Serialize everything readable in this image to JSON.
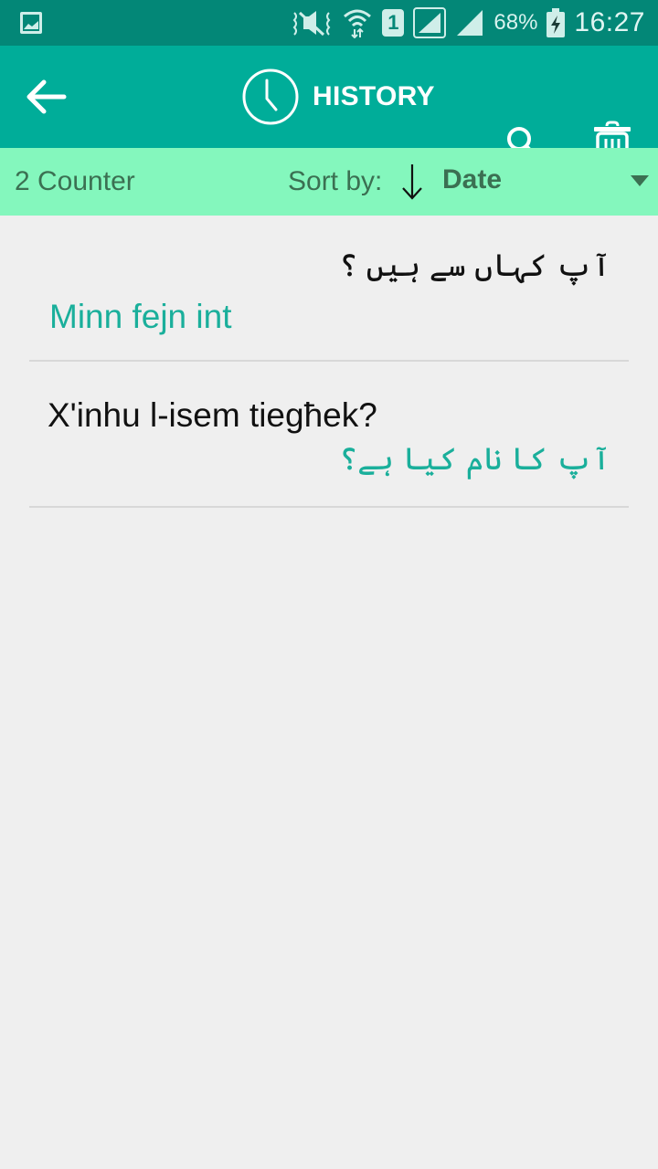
{
  "status_bar": {
    "battery": "68%",
    "time": "16:27",
    "sim_slot": "1",
    "icons": [
      "gallery-icon",
      "vibrate-mute-icon",
      "wifi-icon",
      "sim-icon",
      "signal-icon",
      "signal-icon-2",
      "battery-charging-icon"
    ]
  },
  "app_bar": {
    "title": "HISTORY",
    "back_icon": "arrow-back-icon",
    "title_icon": "clock-icon",
    "search_icon": "search-icon",
    "delete_icon": "trash-icon"
  },
  "sort_bar": {
    "counter": "2 Counter",
    "sort_label": "Sort by:",
    "sort_direction": "descending",
    "sort_value": "Date"
  },
  "history": [
    {
      "source": "آپ کہاں سے ہیں ؟",
      "source_dir": "rtl",
      "translation": "Minn fejn int",
      "translation_dir": "ltr"
    },
    {
      "source": "X'inhu l-isem tiegħek?",
      "source_dir": "ltr",
      "translation": "آپ کا نام کیا ہے؟",
      "translation_dir": "rtl"
    }
  ],
  "colors": {
    "status_bar": "#038777",
    "app_bar": "#00ad99",
    "sort_bar": "#84f7bd",
    "accent_text": "#1aaf9b",
    "background": "#efefef"
  }
}
